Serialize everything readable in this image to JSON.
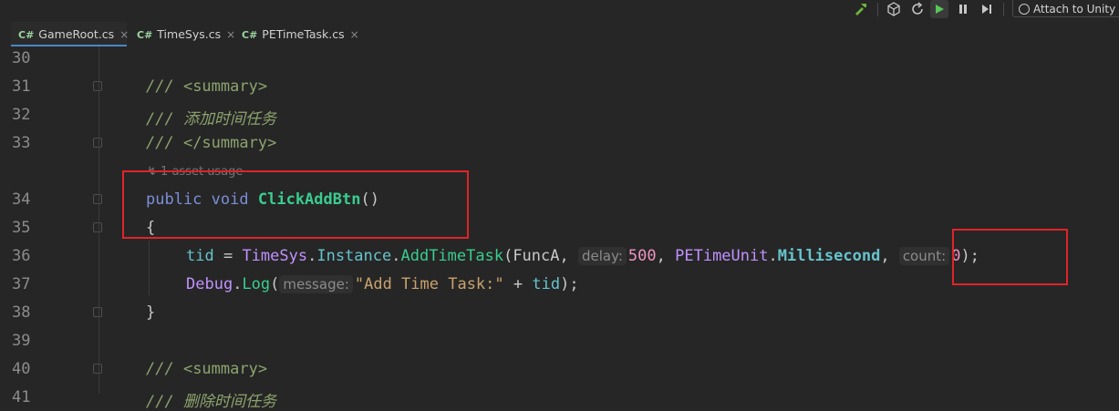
{
  "toolbar": {
    "build_icon": "hammer-icon",
    "unity_icon": "unity-icon",
    "refresh_icon": "refresh-unity-icon",
    "play_icon": "play-icon",
    "pause_icon": "pause-icon",
    "step_icon": "step-icon",
    "attach_label": "Attach to Unity"
  },
  "tabs": [
    {
      "lang": "C#",
      "label": "GameRoot.cs",
      "close": "×"
    },
    {
      "lang": "C#",
      "label": "TimeSys.cs",
      "close": "×"
    },
    {
      "lang": "C#",
      "label": "PETimeTask.cs",
      "close": "×"
    }
  ],
  "line_numbers": [
    "30",
    "31",
    "32",
    "33",
    "34",
    "35",
    "36",
    "37",
    "38",
    "39",
    "40",
    "41"
  ],
  "code": {
    "l31_slashes": "/// ",
    "l31_tag": "<summary>",
    "l32": "/// 添加时间任务",
    "l33_slashes": "/// ",
    "l33_tag": "</summary>",
    "usage": "1 asset usage",
    "l34_public": "public",
    "l34_void": "void",
    "l34_name": "ClickAddBtn",
    "l34_parens": "()",
    "l35": "{",
    "l36_tid": "tid",
    "l36_eq": " = ",
    "l36_timesys": "TimeSys",
    "l36_instance": "Instance",
    "l36_add": "AddTimeTask",
    "l36_funca": "(FuncA, ",
    "l36_delay_hint": "delay:",
    "l36_500": "500",
    "l36_comma": ", ",
    "l36_unit": "PETimeUnit",
    "l36_ms": "Millisecond",
    "l36_comma2": ", ",
    "l36_count_hint": "count:",
    "l36_zero": "0",
    "l36_end": ");",
    "l37_debug": "Debug",
    "l37_log": "Log",
    "l37_open": "(",
    "l37_hint": "message:",
    "l37_str": "\"Add Time Task:\"",
    "l37_plus": " + ",
    "l37_tid": "tid",
    "l37_end": ");",
    "l38": "}",
    "l40_slashes": "/// ",
    "l40_tag": "<summary>",
    "l41": "/// 删除时间任务"
  }
}
